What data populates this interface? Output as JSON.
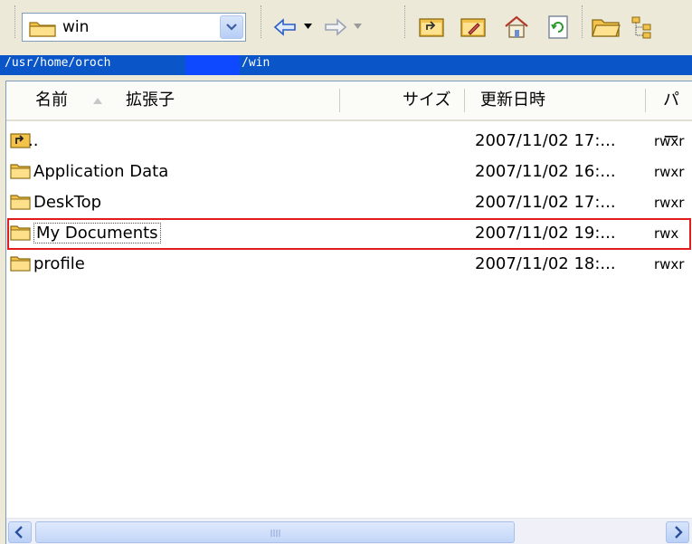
{
  "toolbar": {
    "location_value": "win",
    "icons": [
      "folder-icon",
      "dropdown-arrow-icon",
      "back-icon",
      "forward-icon",
      "parent-folder-icon",
      "rename-folder-icon",
      "home-icon",
      "refresh-icon",
      "open-folder-icon",
      "tree-view-icon"
    ]
  },
  "pathbar": {
    "path_start": "/usr/home/oroch",
    "path_end": "/win"
  },
  "columns": {
    "name": "名前",
    "ext": "拡張子",
    "size": "サイズ",
    "modified": "更新日時",
    "perm": "パー"
  },
  "rows": [
    {
      "name": "..",
      "modified": "2007/11/02 17:...",
      "perm": "rwxr"
    },
    {
      "name": "Application Data",
      "modified": "2007/11/02 16:...",
      "perm": "rwxr"
    },
    {
      "name": "DeskTop",
      "modified": "2007/11/02 17:...",
      "perm": "rwxr"
    },
    {
      "name": "My Documents",
      "modified": "2007/11/02 19:...",
      "perm": "rwx"
    },
    {
      "name": "profile",
      "modified": "2007/11/02 18:...",
      "perm": "rwxr"
    }
  ],
  "colors": {
    "selection_outline": "#e21b1b",
    "pathbar_bg": "#0a56c9"
  }
}
